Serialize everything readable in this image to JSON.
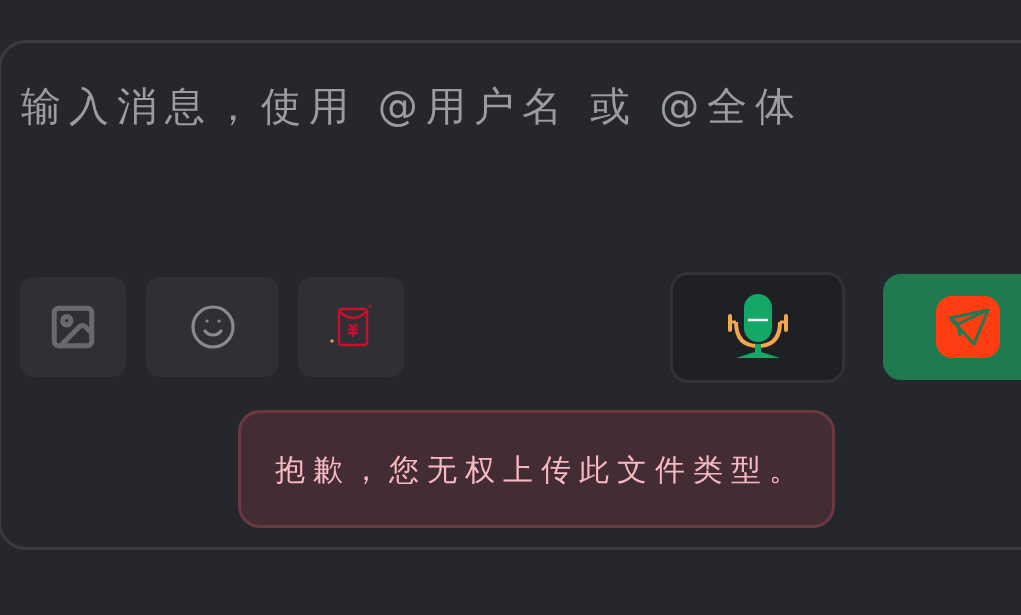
{
  "composer": {
    "placeholder": "输入消息，使用 @用户名 或 @全体"
  },
  "toast": {
    "kind": "error",
    "message": "抱歉，您无权上传此文件类型。"
  }
}
